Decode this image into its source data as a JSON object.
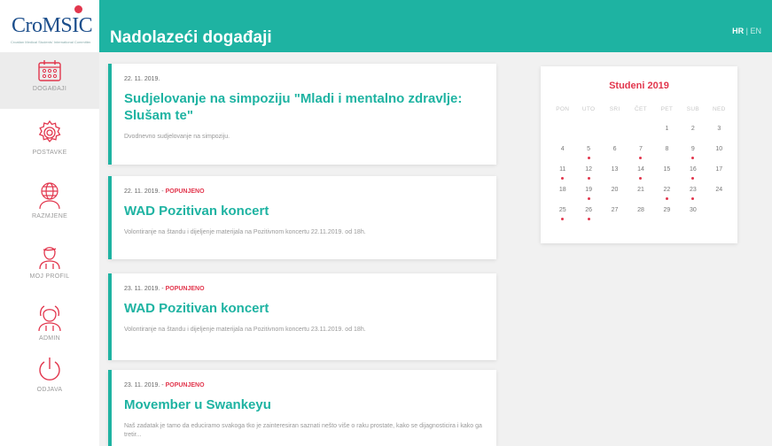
{
  "header": {
    "logo": "CroMSIC",
    "logo_sub": "Croatian Medical Students' International Committee",
    "title": "Nadolazeći događaji",
    "lang_hr": "HR",
    "lang_sep": "|",
    "lang_en": "EN"
  },
  "sidebar": {
    "items": [
      {
        "label": "DOGAĐAJI",
        "icon": "calendar-icon",
        "active": true
      },
      {
        "label": "POSTAVKE",
        "icon": "gear-icon",
        "active": false
      },
      {
        "label": "RAZMJENE",
        "icon": "globe-person-icon",
        "active": false
      },
      {
        "label": "MOJ PROFIL",
        "icon": "user-icon",
        "active": false
      },
      {
        "label": "ADMIN",
        "icon": "admin-icon",
        "active": false
      },
      {
        "label": "ODJAVA",
        "icon": "power-icon",
        "active": false
      }
    ]
  },
  "events": [
    {
      "date": "22. 11. 2019.",
      "status": "",
      "title": "Sudjelovanje na simpoziju \"Mladi i mentalno zdravlje: Slušam te\"",
      "description": "Dvodnevno sudjelovanje na simpoziju."
    },
    {
      "date": "22. 11. 2019. - ",
      "status": "POPUNJENO",
      "title": "WAD Pozitivan koncert",
      "description": "Volontiranje na štandu i dijeljenje materijala na Pozitivnom koncertu 22.11.2019. od 18h."
    },
    {
      "date": "23. 11. 2019. - ",
      "status": "POPUNJENO",
      "title": "WAD Pozitivan koncert",
      "description": "Volontiranje na štandu i dijeljenje materijala na Pozitivnom koncertu 23.11.2019. od 18h."
    },
    {
      "date": "23. 11. 2019. - ",
      "status": "POPUNJENO",
      "title": "Movember u Swankeyu",
      "description": "Naš zadatak je tamo da educiramo svakoga tko je zainteresiran saznati nešto više o raku prostate, kako se dijagnosticira i kako ga tretir..."
    }
  ],
  "calendar": {
    "title": "Studeni 2019",
    "weekdays": [
      "PON",
      "UTO",
      "SRI",
      "ČET",
      "PET",
      "SUB",
      "NED"
    ],
    "leading_blanks": 4,
    "days": [
      "1",
      "2",
      "3",
      "4",
      "5",
      "6",
      "7",
      "8",
      "9",
      "10",
      "11",
      "12",
      "13",
      "14",
      "15",
      "16",
      "17",
      "18",
      "19",
      "20",
      "21",
      "22",
      "23",
      "24",
      "25",
      "26",
      "27",
      "28",
      "29",
      "30"
    ],
    "event_days": [
      "5",
      "7",
      "9",
      "11",
      "12",
      "14",
      "16",
      "19",
      "22",
      "23",
      "25",
      "26"
    ],
    "accent_color": "#e2364d"
  },
  "colors": {
    "primary": "#1eb3a2",
    "accent": "#e2364d"
  }
}
